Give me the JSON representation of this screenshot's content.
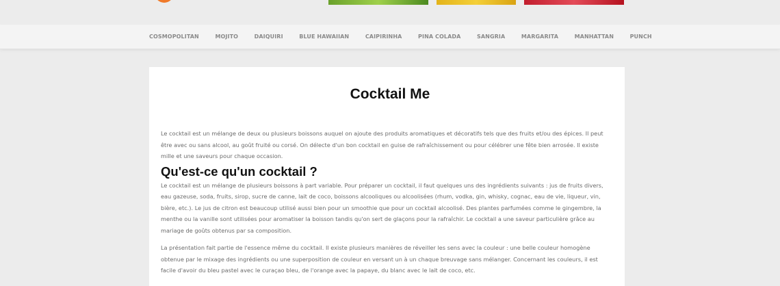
{
  "header": {
    "logo_icon": "logo-icon",
    "banner_images": [
      "green-cocktail-image",
      "yellow-cocktail-image",
      "red-cocktail-image"
    ]
  },
  "nav": {
    "items": [
      "COSMOPOLITAN",
      "MOJITO",
      "DAIQUIRI",
      "BLUE HAWAIIAN",
      "CAIPIRINHA",
      "PINA COLADA",
      "SANGRIA",
      "MARGARITA",
      "MANHATTAN",
      "PUNCH"
    ]
  },
  "article": {
    "title": "Cocktail Me",
    "intro": "Le cocktail est un mélange de deux ou plusieurs boissons auquel on ajoute des produits aromatiques et décoratifs tels que des fruits et/ou des épices. Il peut être avec ou sans alcool, au goût fruité ou corsé. On délecte d'un bon cocktail en guise de rafraîchissement ou pour célébrer une fête bien arrosée. Il existe mille et une saveurs pour chaque occasion.",
    "heading": "Qu'est-ce qu'un cocktail ?",
    "para1": "Le cocktail est un mélange de plusieurs boissons à part variable. Pour préparer un cocktail, il faut quelques uns des ingrédients suivants : jus de fruits divers, eau gazeuse, soda, fruits, sirop, sucre de canne, lait de coco, boissons alcooliques ou alcoolisées (rhum, vodka, gin, whisky, cognac, eau de vie, liqueur, vin, bière, etc.). Le jus de citron est beaucoup utilisé aussi bien pour un smoothie que pour un cocktail alcoolisé. Des plantes parfumées comme le gingembre, la menthe ou la vanille sont utilisées pour aromatiser la boisson tandis qu'on sert de glaçons pour la rafraîchir. Le cocktail a une saveur particulière grâce au mariage de goûts obtenus par sa composition.",
    "para2": "La présentation fait partie de l'essence même du cocktail. Il existe plusieurs manières de réveiller les sens avec la couleur : une belle couleur homogène obtenue par le mixage des ingrédients ou une superposition de couleur en versant un à un chaque breuvage sans mélanger. Concernant les couleurs, il est facile d'avoir du bleu pastel avec le curaçao bleu, de l'orange avec la papaye, du blanc avec le lait de coco, etc."
  },
  "colors": {
    "background": "#ececec",
    "nav_background": "#f4f4f4",
    "nav_text": "#8a8a8a",
    "body_text": "#6b6b6b",
    "heading_text": "#111111",
    "logo_orange": "#f07a2a"
  }
}
